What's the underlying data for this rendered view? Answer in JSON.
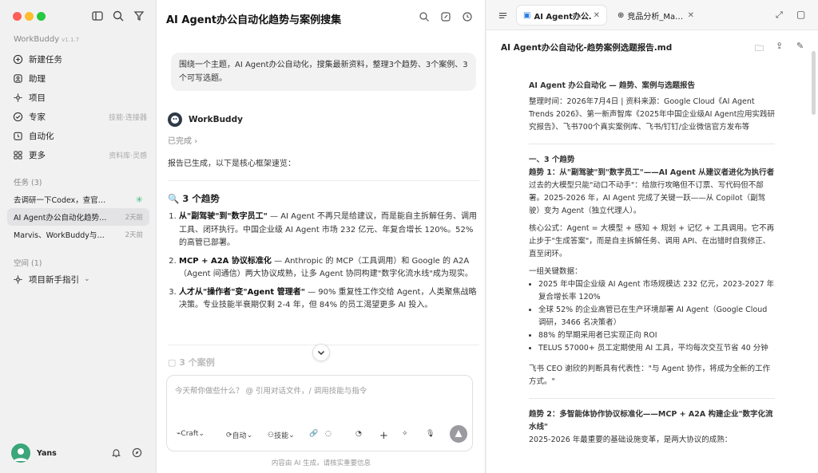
{
  "sidebar": {
    "brand": "WorkBuddy",
    "version": "v1.1.7",
    "nav": [
      {
        "label": "新建任务",
        "hint": "",
        "icon": "plus-circle-icon"
      },
      {
        "label": "助理",
        "hint": "",
        "icon": "assistant-icon"
      },
      {
        "label": "项目",
        "hint": "",
        "icon": "project-icon"
      },
      {
        "label": "专家",
        "hint": "技能·连接器",
        "icon": "expert-icon"
      },
      {
        "label": "自动化",
        "hint": "",
        "icon": "clock-icon"
      },
      {
        "label": "更多",
        "hint": "资料库·灵感",
        "icon": "more-icon"
      }
    ],
    "tasks_header": "任务 (3)",
    "tasks": [
      {
        "title": "去调研一下Codex，查官网、…",
        "when": ""
      },
      {
        "title": "AI Agent办公自动化趋势与…",
        "when": "2天前"
      },
      {
        "title": "Marvis、WorkBuddy与Qcla…",
        "when": "2天前"
      }
    ],
    "spaces_header": "空间 (1)",
    "space_item": "项目新手指引",
    "user": "Yans"
  },
  "chat": {
    "title": "AI Agent办公自动化趋势与案例搜集",
    "prompt": "围绕一个主题，AI Agent办公自动化，搜集最新资料，整理3个趋势、3个案例、3个可写选题。",
    "bot_name": "WorkBuddy",
    "status": "已完成",
    "intro": "报告已生成，以下是核心框架速览：",
    "trends_heading": "🔍 3 个趋势",
    "trends": [
      {
        "title": "从\"副驾驶\"到\"数字员工\"",
        "body": " — AI Agent 不再只是给建议，而是能自主拆解任务、调用工具、闭环执行。中国企业级 AI Agent 市场 232 亿元、年复合增长 120%。52% 的高管已部署。"
      },
      {
        "title": "MCP + A2A 协议标准化",
        "body": " — Anthropic 的 MCP（工具调用）和 Google 的 A2A（Agent 间通信）两大协议成熟，让多 Agent 协同构建\"数字化流水线\"成为现实。"
      },
      {
        "title": "人才从\"操作者\"变\"Agent 管理者\"",
        "body": " — 90% 重复性工作交给 Agent，人类聚焦战略决策。专业技能半衰期仅剩 2-4 年，但 84% 的员工渴望更多 AI 投入。"
      }
    ],
    "cases_heading": "3 个案例",
    "input_placeholder": "今天帮你做些什么？ @ 引用对话文件，/ 调用技能与指令",
    "tools": {
      "craft": "Craft",
      "auto": "自动",
      "skills": "技能"
    },
    "footer": "内容由 AI 生成，请核实重要信息"
  },
  "doc": {
    "tabs": [
      "AI Agent办公…",
      "竞品分析_Ma…"
    ],
    "file_name": "AI Agent办公自动化-趋势案例选题报告.md",
    "title": "AI Agent 办公自动化 — 趋势、案例与选题报告",
    "meta": "整理时间：2026年7月4日 | 资料来源：Google Cloud《AI Agent Trends 2026》、第一新声智库《2025年中国企业级AI Agent应用实践研究报告》、飞书700个真实案例库、飞书/钉钉/企业微信官方发布等",
    "section1": "一、3 个趋势",
    "trend1_heading": "趋势 1：从\"副驾驶\"到\"数字员工\"——AI Agent 从建议者进化为执行者",
    "trend1_p1": "过去的大模型只能\"动口不动手\"：给旅行攻略但不订票、写代码但不部署。2025-2026 年，AI Agent 完成了关键一跃——从 Copilot（副驾驶）变为 Agent（独立代理人）。",
    "trend1_formula": "核心公式：Agent = 大模型 + 感知 + 规划 + 记忆 + 工具调用。它不再止步于\"生成答案\"，而是自主拆解任务、调用 API、在出错时自我修正、直至闭环。",
    "data_label": "一组关键数据：",
    "bullets": [
      "2025 年中国企业级 AI Agent 市场规模达 232 亿元，2023-2027 年复合增长率 120%",
      "全球 52% 的企业高管已在生产环境部署 AI Agent（Google Cloud 调研，3466 名决策者）",
      "88% 的早期采用者已实现正向 ROI",
      "TELUS 57000+ 员工定期使用 AI 工具，平均每次交互节省 40 分钟"
    ],
    "quote": "飞书 CEO 谢欣的判断具有代表性：\"与 Agent 协作，将成为全新的工作方式。\"",
    "trend2_heading": "趋势 2：多智能体协作协议标准化——MCP + A2A 构建企业\"数字化流水线\"",
    "trend2_p": "2025-2026 年最重要的基础设施变革，是两大协议的成熟："
  },
  "colors": {
    "accent": "#28c840",
    "avatar": "#3aa67a",
    "send": "#9a9aa0"
  }
}
